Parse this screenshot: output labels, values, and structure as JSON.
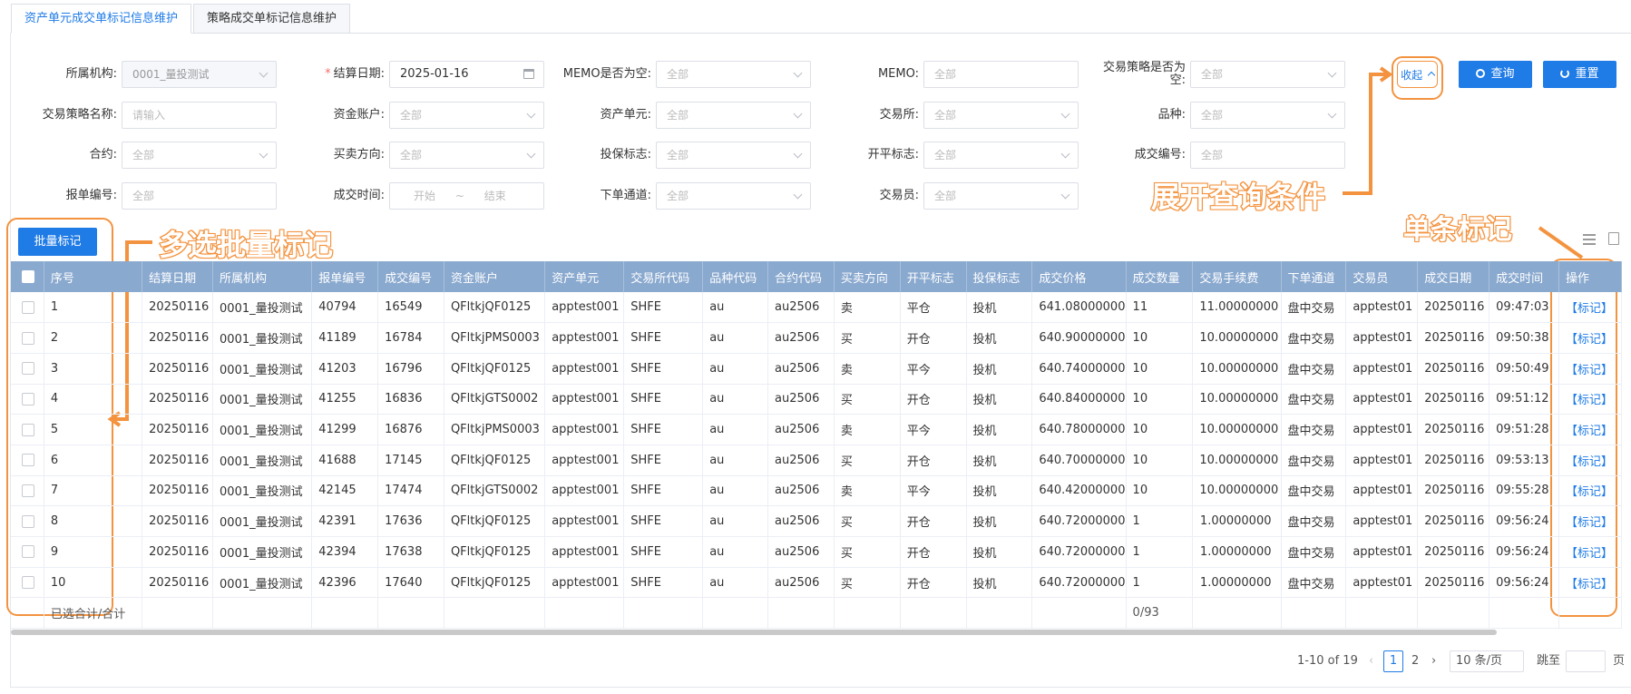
{
  "tabs": [
    "资产单元成交单标记信息维护",
    "策略成交单标记信息维护"
  ],
  "form": {
    "org_label": "所属机构:",
    "org_value": "0001_量投测试",
    "date_label": "结算日期:",
    "date_value": "2025-01-16",
    "memo_empty_label": "MEMO是否为空:",
    "memo_empty_value": "全部",
    "memo_label": "MEMO:",
    "memo_value": "全部",
    "strategy_empty_label": "交易策略是否为空:",
    "strategy_empty_value": "全部",
    "strategy_name_label": "交易策略名称:",
    "strategy_name_placeholder": "请输入",
    "account_label": "资金账户:",
    "account_value": "全部",
    "asset_unit_label": "资产单元:",
    "asset_unit_value": "全部",
    "exchange_label": "交易所:",
    "exchange_value": "全部",
    "variety_label": "品种:",
    "variety_value": "全部",
    "contract_label": "合约:",
    "contract_value": "全部",
    "direction_label": "买卖方向:",
    "direction_value": "全部",
    "hedge_label": "投保标志:",
    "hedge_value": "全部",
    "openclose_label": "开平标志:",
    "openclose_value": "全部",
    "trade_no_label": "成交编号:",
    "trade_no_value": "全部",
    "order_no_label": "报单编号:",
    "order_no_value": "全部",
    "trade_time_label": "成交时间:",
    "trade_time_start": "开始",
    "trade_time_sep": "~",
    "trade_time_end": "结束",
    "channel_label": "下单通道:",
    "channel_value": "全部",
    "trader_label": "交易员:",
    "trader_value": "全部"
  },
  "buttons": {
    "collapse": "收起",
    "search": "查询",
    "reset": "重置",
    "batch_mark": "批量标记"
  },
  "annotations": {
    "expand_query": "展开查询条件",
    "batch_select": "多选批量标记",
    "single_mark": "单条标记"
  },
  "table": {
    "columns": [
      "序号",
      "结算日期",
      "所属机构",
      "报单编号",
      "成交编号",
      "资金账户",
      "资产单元",
      "交易所代码",
      "品种代码",
      "合约代码",
      "买卖方向",
      "开平标志",
      "投保标志",
      "成交价格",
      "成交数量",
      "交易手续费",
      "下单通道",
      "交易员",
      "成交日期",
      "成交时间",
      "操作"
    ],
    "rows": [
      [
        "1",
        "20250116",
        "0001_量投测试",
        "40794",
        "16549",
        "QFltkjQF0125",
        "apptest001",
        "SHFE",
        "au",
        "au2506",
        "卖",
        "平仓",
        "投机",
        "641.08000000",
        "11",
        "11.00000000",
        "盘中交易",
        "apptest01",
        "20250116",
        "09:47:03",
        "【标记】"
      ],
      [
        "2",
        "20250116",
        "0001_量投测试",
        "41189",
        "16784",
        "QFltkjPMS0003",
        "apptest001",
        "SHFE",
        "au",
        "au2506",
        "买",
        "开仓",
        "投机",
        "640.90000000",
        "10",
        "10.00000000",
        "盘中交易",
        "apptest01",
        "20250116",
        "09:50:38",
        "【标记】"
      ],
      [
        "3",
        "20250116",
        "0001_量投测试",
        "41203",
        "16796",
        "QFltkjQF0125",
        "apptest001",
        "SHFE",
        "au",
        "au2506",
        "卖",
        "平今",
        "投机",
        "640.74000000",
        "10",
        "10.00000000",
        "盘中交易",
        "apptest01",
        "20250116",
        "09:50:49",
        "【标记】"
      ],
      [
        "4",
        "20250116",
        "0001_量投测试",
        "41255",
        "16836",
        "QFltkjGTS0002",
        "apptest001",
        "SHFE",
        "au",
        "au2506",
        "买",
        "开仓",
        "投机",
        "640.84000000",
        "10",
        "10.00000000",
        "盘中交易",
        "apptest01",
        "20250116",
        "09:51:12",
        "【标记】"
      ],
      [
        "5",
        "20250116",
        "0001_量投测试",
        "41299",
        "16876",
        "QFltkjPMS0003",
        "apptest001",
        "SHFE",
        "au",
        "au2506",
        "卖",
        "平今",
        "投机",
        "640.78000000",
        "10",
        "10.00000000",
        "盘中交易",
        "apptest01",
        "20250116",
        "09:51:28",
        "【标记】"
      ],
      [
        "6",
        "20250116",
        "0001_量投测试",
        "41688",
        "17145",
        "QFltkjQF0125",
        "apptest001",
        "SHFE",
        "au",
        "au2506",
        "买",
        "开仓",
        "投机",
        "640.70000000",
        "10",
        "10.00000000",
        "盘中交易",
        "apptest01",
        "20250116",
        "09:53:13",
        "【标记】"
      ],
      [
        "7",
        "20250116",
        "0001_量投测试",
        "42145",
        "17474",
        "QFltkjGTS0002",
        "apptest001",
        "SHFE",
        "au",
        "au2506",
        "卖",
        "平今",
        "投机",
        "640.42000000",
        "10",
        "10.00000000",
        "盘中交易",
        "apptest01",
        "20250116",
        "09:55:28",
        "【标记】"
      ],
      [
        "8",
        "20250116",
        "0001_量投测试",
        "42391",
        "17636",
        "QFltkjQF0125",
        "apptest001",
        "SHFE",
        "au",
        "au2506",
        "买",
        "开仓",
        "投机",
        "640.72000000",
        "1",
        "1.00000000",
        "盘中交易",
        "apptest01",
        "20250116",
        "09:56:24",
        "【标记】"
      ],
      [
        "9",
        "20250116",
        "0001_量投测试",
        "42394",
        "17638",
        "QFltkjQF0125",
        "apptest001",
        "SHFE",
        "au",
        "au2506",
        "买",
        "开仓",
        "投机",
        "640.72000000",
        "1",
        "1.00000000",
        "盘中交易",
        "apptest01",
        "20250116",
        "09:56:24",
        "【标记】"
      ],
      [
        "10",
        "20250116",
        "0001_量投测试",
        "42396",
        "17640",
        "QFltkjQF0125",
        "apptest001",
        "SHFE",
        "au",
        "au2506",
        "买",
        "开仓",
        "投机",
        "640.72000000",
        "1",
        "1.00000000",
        "盘中交易",
        "apptest01",
        "20250116",
        "09:56:24",
        "【标记】"
      ]
    ],
    "summary_label": "已选合计/合计",
    "summary_qty": "0/93"
  },
  "pagination": {
    "range": "1-10 of 19",
    "pages": [
      "1",
      "2"
    ],
    "page_size": "10 条/页",
    "goto_label": "跳至",
    "page_suffix": "页"
  },
  "colors": {
    "primary": "#1f7be6",
    "header_bg": "#8aa9cf",
    "annotation": "#f3933f"
  }
}
